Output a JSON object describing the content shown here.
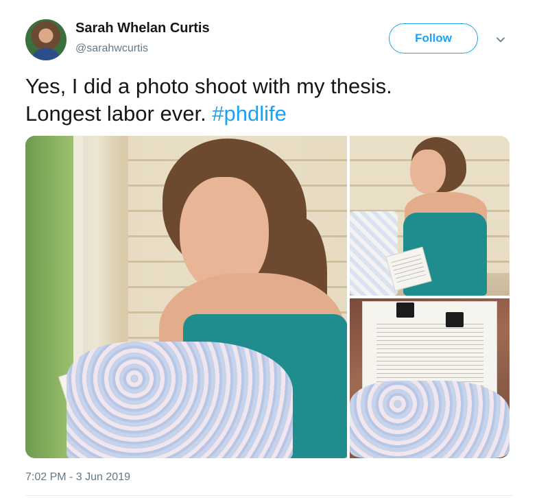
{
  "author": {
    "name": "Sarah Whelan Curtis",
    "handle": "@sarahwcurtis",
    "avatar_icon": "profile-photo"
  },
  "follow_button": {
    "label": "Follow"
  },
  "menu_icon": "chevron-down-icon",
  "tweet": {
    "line1": "Yes, I did a photo shoot with my thesis.",
    "line2_text": "Longest labor ever. ",
    "hashtag": "#phdlife"
  },
  "media": {
    "photos": [
      {
        "name": "photo-1",
        "subject": "woman holding thesis wrapped in crocheted blanket by window"
      },
      {
        "name": "photo-2",
        "subject": "woman in teal dress holding thesis against belly"
      },
      {
        "name": "photo-3",
        "subject": "thesis with binder clips wrapped in crocheted blanket"
      }
    ]
  },
  "timestamp": "7:02 PM - 3 Jun 2019",
  "colors": {
    "accent": "#1da1f2",
    "text": "#14171a",
    "muted": "#657786"
  }
}
